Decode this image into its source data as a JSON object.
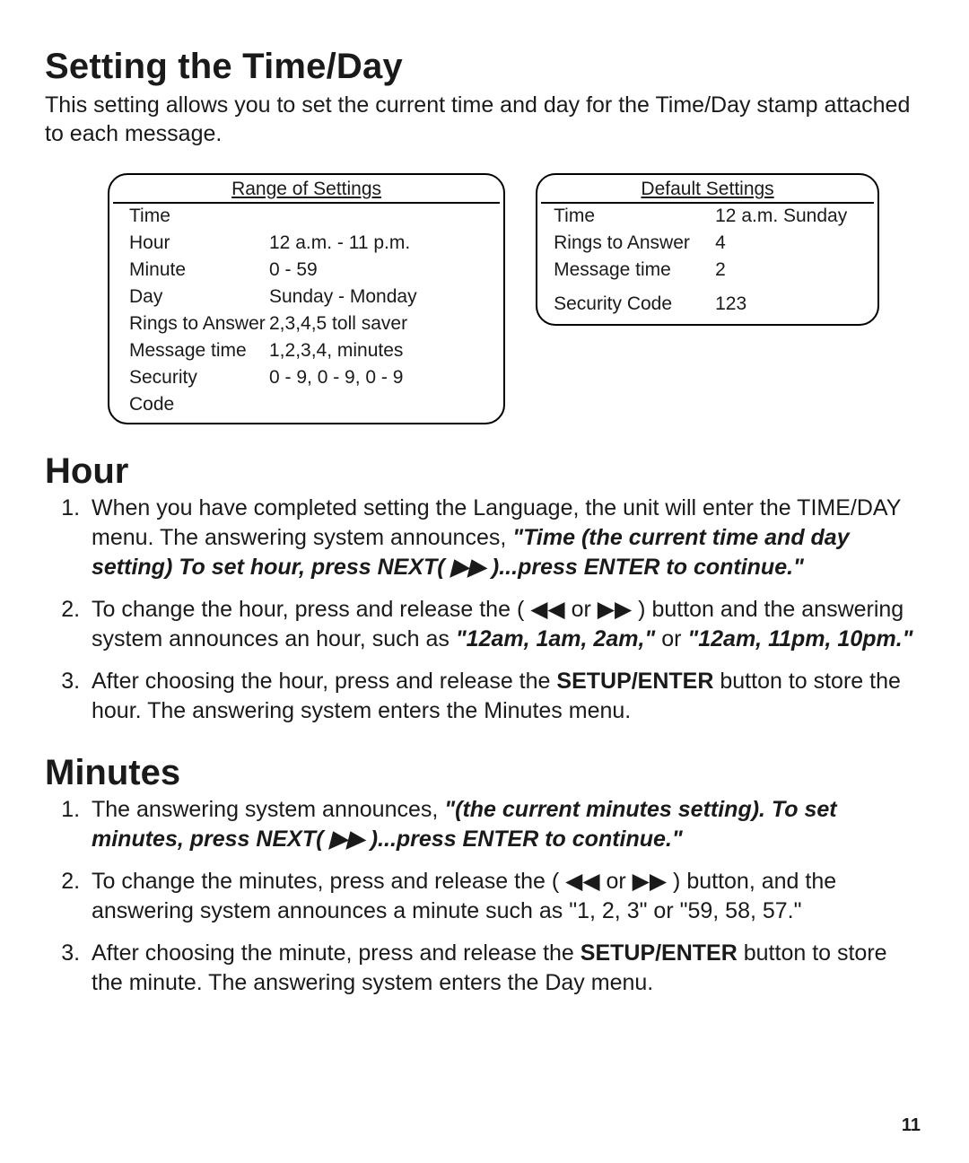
{
  "title": "Setting the Time/Day",
  "intro": "This setting allows you to set the current time and day for the Time/Day stamp attached to each message.",
  "range_table": {
    "header": "Range of Settings",
    "time_label": "Time",
    "rows": [
      {
        "k": "Hour",
        "v": "12 a.m. - 11 p.m."
      },
      {
        "k": "Minute",
        "v": "0 - 59"
      },
      {
        "k": "Day",
        "v": "Sunday - Monday"
      },
      {
        "k": "Rings to Answer",
        "v": "2,3,4,5 toll saver"
      },
      {
        "k": "Message time",
        "v": "1,2,3,4, minutes"
      },
      {
        "k": "Security",
        "v": "0 - 9, 0 - 9, 0 - 9"
      },
      {
        "k": "Code",
        "v": ""
      }
    ]
  },
  "default_table": {
    "header": "Default Settings",
    "rows": [
      {
        "k": "Time",
        "v": "12 a.m. Sunday"
      },
      {
        "k": "Rings to Answer",
        "v": "4"
      },
      {
        "k": "Message time",
        "v": "2"
      }
    ],
    "security_row": {
      "k": "Security Code",
      "v": "123"
    }
  },
  "sections": {
    "hour": {
      "heading": "Hour",
      "step1_a": "When you have completed setting the Language, the unit will enter the TIME/DAY menu. The answering system announces, ",
      "step1_b": "\"Time (the current time and day setting) To set hour, press NEXT( ▶▶ )...press ENTER to continue.\"",
      "step2_a": "To change the hour, press and release the ( ◀◀ or ▶▶ ) button and the answering system announces an hour, such as ",
      "step2_b": "\"12am, 1am, 2am,\"",
      "step2_c": " or ",
      "step2_d": "\"12am, 11pm, 10pm.\"",
      "step3_a": "After choosing the hour, press and release the ",
      "step3_b": "SETUP/ENTER",
      "step3_c": " button to store the hour. The answering system enters the Minutes menu."
    },
    "minutes": {
      "heading": "Minutes",
      "step1_a": "The answering system announces, ",
      "step1_b": "\"(the current minutes setting).  To set minutes, press NEXT( ▶▶ )...press ENTER to continue.\"",
      "step2": " To change the minutes, press and release the ( ◀◀ or ▶▶ ) button, and the answering system announces a minute such as \"1, 2, 3\" or \"59, 58, 57.\"",
      "step3_a": "After choosing the minute, press and release the ",
      "step3_b": "SETUP/ENTER",
      "step3_c": " button to store the minute. The answering system enters the Day menu."
    }
  },
  "page_number": "11"
}
